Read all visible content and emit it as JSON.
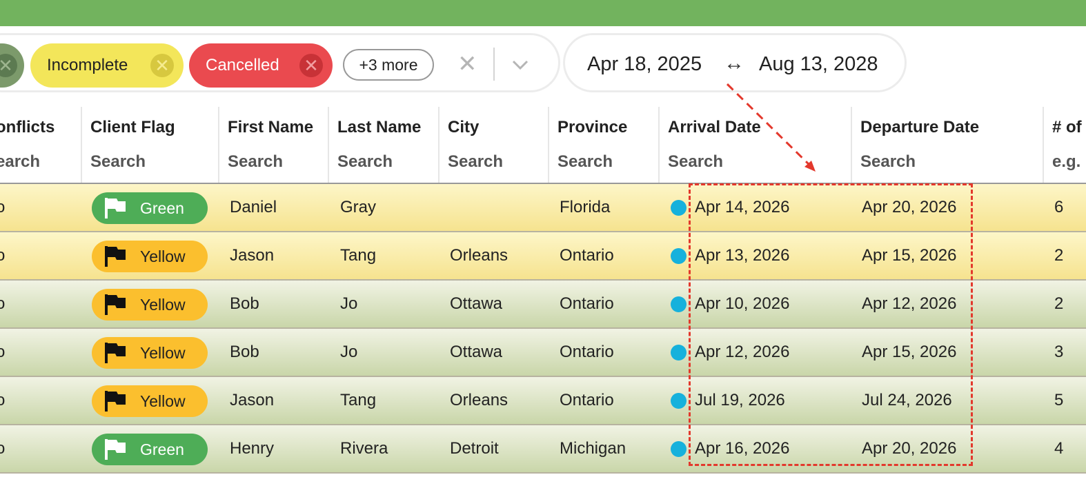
{
  "filters": {
    "chips": [
      {
        "label": "Incomplete"
      },
      {
        "label": "Cancelled"
      }
    ],
    "more_label": "+3 more",
    "clear_glyph": "✕"
  },
  "date_range": {
    "start": "Apr 18, 2025",
    "arrow": "↔",
    "end": "Aug 13, 2028"
  },
  "table": {
    "columns": [
      {
        "title": "onflicts",
        "search": "earch"
      },
      {
        "title": "Client Flag",
        "search": "Search"
      },
      {
        "title": "First Name",
        "search": "Search"
      },
      {
        "title": "Last Name",
        "search": "Search"
      },
      {
        "title": "City",
        "search": "Search"
      },
      {
        "title": "Province",
        "search": "Search"
      },
      {
        "title": "Arrival Date",
        "search": "Search"
      },
      {
        "title": "Departure Date",
        "search": "Search"
      },
      {
        "title": "# of",
        "search": "e.g."
      }
    ],
    "rows": [
      {
        "conflict": "o",
        "flag": "Green",
        "first": "Daniel",
        "last": "Gray",
        "city": "",
        "province": "Florida",
        "arrival": "Apr 14, 2026",
        "departure": "Apr 20, 2026",
        "count": "6"
      },
      {
        "conflict": "o",
        "flag": "Yellow",
        "first": "Jason",
        "last": "Tang",
        "city": "Orleans",
        "province": "Ontario",
        "arrival": "Apr 13, 2026",
        "departure": "Apr 15, 2026",
        "count": "2"
      },
      {
        "conflict": "o",
        "flag": "Yellow",
        "first": "Bob",
        "last": "Jo",
        "city": "Ottawa",
        "province": "Ontario",
        "arrival": "Apr 10, 2026",
        "departure": "Apr 12, 2026",
        "count": "2"
      },
      {
        "conflict": "o",
        "flag": "Yellow",
        "first": "Bob",
        "last": "Jo",
        "city": "Ottawa",
        "province": "Ontario",
        "arrival": "Apr 12, 2026",
        "departure": "Apr 15, 2026",
        "count": "3"
      },
      {
        "conflict": "o",
        "flag": "Yellow",
        "first": "Jason",
        "last": "Tang",
        "city": "Orleans",
        "province": "Ontario",
        "arrival": "Jul 19, 2026",
        "departure": "Jul 24, 2026",
        "count": "5"
      },
      {
        "conflict": "o",
        "flag": "Green",
        "first": "Henry",
        "last": "Rivera",
        "city": "Detroit",
        "province": "Michigan",
        "arrival": "Apr 16, 2026",
        "departure": "Apr 20, 2026",
        "count": "4"
      }
    ]
  },
  "colors": {
    "topbar": "#72b35e",
    "chip_yellow": "#f3e65a",
    "chip_red": "#ea4a4f",
    "flag_green": "#4ead57",
    "flag_yellow": "#fbbf2e",
    "row_yellow": "#f6e38f",
    "row_green": "#c9d6a9",
    "status_dot": "#16b1dc",
    "annotation": "#e3382c"
  },
  "icons": {
    "chip_remove": "x-circle-icon",
    "clear": "close-icon",
    "dropdown": "chevron-down-icon",
    "flag": "flag-icon",
    "status": "status-dot-icon"
  }
}
